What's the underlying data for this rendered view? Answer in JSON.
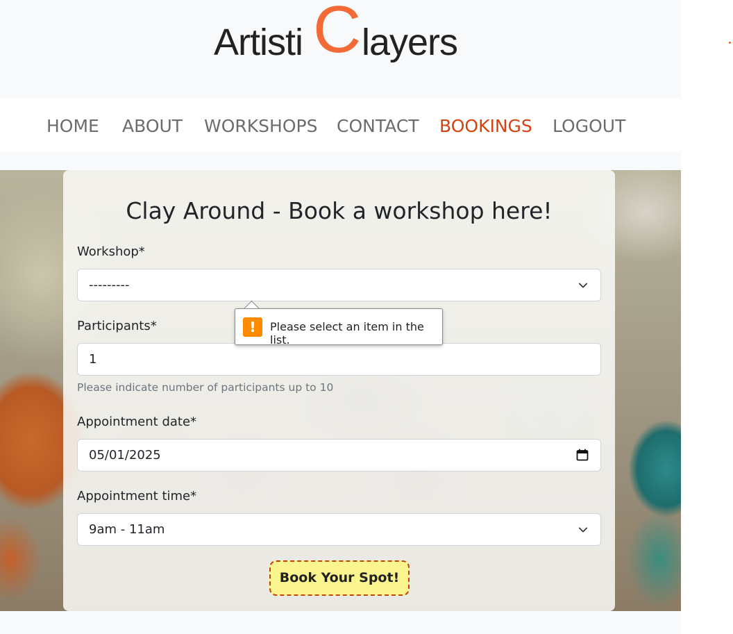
{
  "brand": {
    "part1": "Artisti",
    "big_letter": "C",
    "part2": "layers",
    "accent_color": "#f26a35"
  },
  "nav": {
    "items": [
      {
        "label": "HOME"
      },
      {
        "label": "ABOUT"
      },
      {
        "label": "WORKSHOPS"
      },
      {
        "label": "CONTACT"
      },
      {
        "label": "BOOKINGS",
        "active": true
      },
      {
        "label": "LOGOUT"
      }
    ],
    "active_color": "#d8410d"
  },
  "form": {
    "title": "Clay Around - Book a workshop here!",
    "workshop": {
      "label": "Workshop*",
      "value": "---------"
    },
    "participants": {
      "label": "Participants*",
      "value": "1",
      "help": "Please indicate number of participants up to 10"
    },
    "date": {
      "label": "Appointment date*",
      "value": "05/01/2025"
    },
    "time": {
      "label": "Appointment time*",
      "value": "9am - 11am"
    },
    "submit_label": "Book Your Spot!"
  },
  "validation_tooltip": {
    "icon": "warning-icon",
    "message": "Please select an item in the list."
  }
}
